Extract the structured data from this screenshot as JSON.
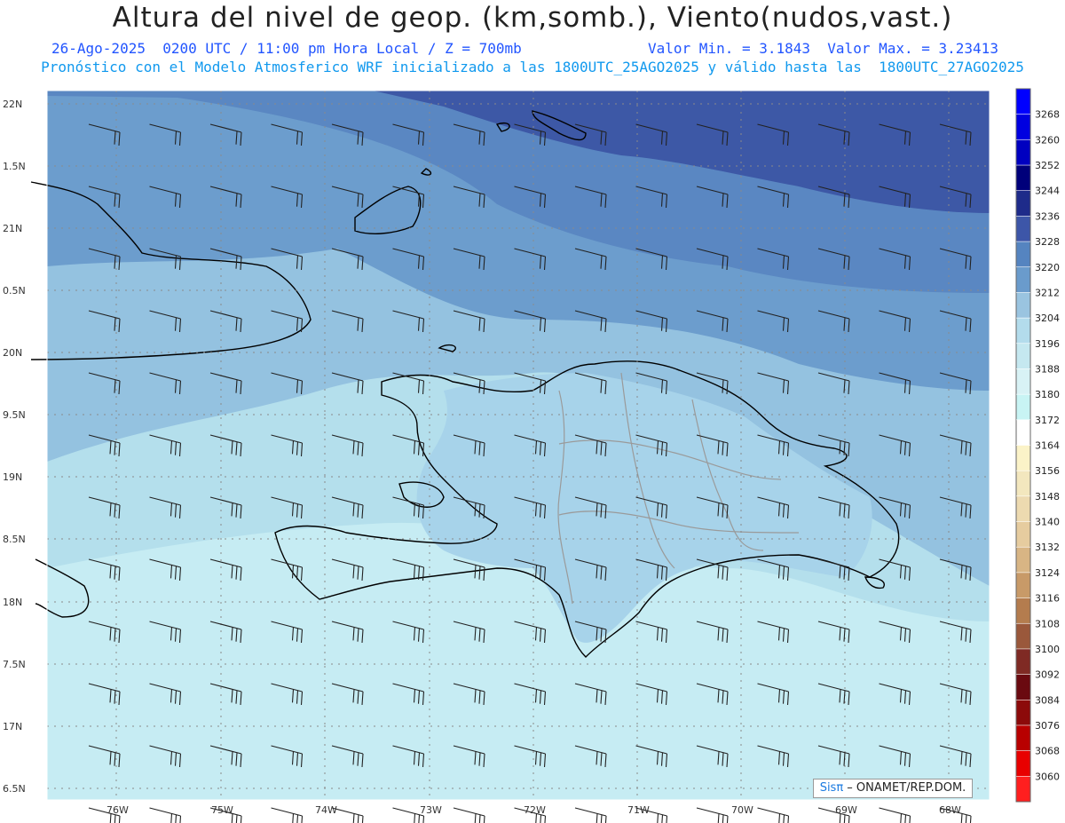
{
  "header": {
    "title": "Altura del nivel de geop. (km,somb.), Viento(nudos,vast.)",
    "line1_date": "26-Ago-2025  0200 UTC / 11:00 pm Hora Local / Z = 700mb",
    "line1_minmax": "Valor Min. = 3.1843  Valor Max. = 3.23413",
    "line2": "Pronóstico con el Modelo Atmosferico WRF inicializado a las 1800UTC_25AGO2025 y válido hasta las  1800UTC_27AGO2025"
  },
  "map": {
    "lat_labels": [
      "22N",
      "1.5N",
      "21N",
      "0.5N",
      "20N",
      "9.5N",
      "19N",
      "8.5N",
      "18N",
      "7.5N",
      "17N",
      "6.5N"
    ],
    "lon_labels": [
      "76W",
      "75W",
      "74W",
      "73W",
      "72W",
      "71W",
      "70W",
      "69W",
      "68W"
    ],
    "credit_brand": "Sisπ",
    "credit_org": " – ONAMET/REP.DOM."
  },
  "colorbar": {
    "levels": [
      "3268",
      "3260",
      "3252",
      "3244",
      "3236",
      "3228",
      "3220",
      "3212",
      "3204",
      "3196",
      "3188",
      "3180",
      "3172",
      "3164",
      "3156",
      "3148",
      "3140",
      "3132",
      "3124",
      "3116",
      "3108",
      "3100",
      "3092",
      "3084",
      "3076",
      "3068",
      "3060"
    ],
    "colors": [
      "#0000ff",
      "#0000e0",
      "#0000c0",
      "#00007a",
      "#1e2b8a",
      "#3d56a8",
      "#5584c0",
      "#6a9bcc",
      "#9ac4e0",
      "#b3dcec",
      "#c5e8f0",
      "#d8f2f5",
      "#c8f4f4",
      "#ffffff",
      "#fbf3c8",
      "#f3e7be",
      "#eddab0",
      "#e6cc9f",
      "#d8b584",
      "#c89a68",
      "#b47c4e",
      "#9a583b",
      "#7f2a24",
      "#6a0a10",
      "#8c0a0a",
      "#b80000",
      "#e80000",
      "#ff1f1f"
    ]
  }
}
